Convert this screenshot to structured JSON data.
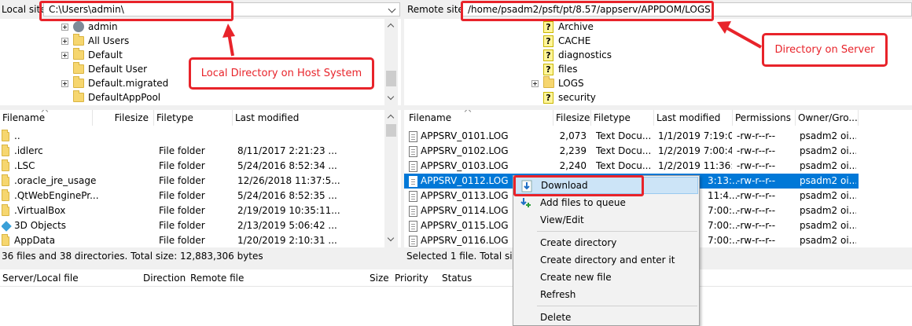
{
  "local": {
    "site_label": "Local site:",
    "path": "C:\\Users\\admin\\",
    "tree": [
      {
        "label": "admin",
        "icon": "user-icon",
        "expander": true
      },
      {
        "label": "All Users",
        "icon": "folder-icon",
        "expander": true
      },
      {
        "label": "Default",
        "icon": "folder-icon",
        "expander": true
      },
      {
        "label": "Default User",
        "icon": "folder-icon",
        "expander": false
      },
      {
        "label": "Default.migrated",
        "icon": "folder-icon",
        "expander": true
      },
      {
        "label": "DefaultAppPool",
        "icon": "folder-icon",
        "expander": false
      }
    ],
    "columns": {
      "filename": "Filename",
      "filesize": "Filesize",
      "filetype": "Filetype",
      "modified": "Last modified"
    },
    "files": [
      {
        "name": "..",
        "type": "",
        "modified": ""
      },
      {
        "name": ".idlerc",
        "type": "File folder",
        "modified": "8/11/2017 2:21:23 ..."
      },
      {
        "name": ".LSC",
        "type": "File folder",
        "modified": "5/24/2016 8:52:34 ..."
      },
      {
        "name": ".oracle_jre_usage",
        "type": "File folder",
        "modified": "12/26/2018 11:37:5..."
      },
      {
        "name": ".QtWebEnginePr...",
        "type": "File folder",
        "modified": "5/24/2016 8:52:35 ..."
      },
      {
        "name": ".VirtualBox",
        "type": "File folder",
        "modified": "2/19/2019 10:35:11..."
      },
      {
        "name": "3D Objects",
        "type": "File folder",
        "modified": "2/13/2019 5:06:42 ..."
      },
      {
        "name": "AppData",
        "type": "File folder",
        "modified": "1/20/2019 2:10:31 ..."
      }
    ],
    "status": "36 files and 38 directories. Total size: 12,883,306 bytes"
  },
  "remote": {
    "site_label": "Remote site:",
    "path": "/home/psadm2/psft/pt/8.57/appserv/APPDOM/LOGS",
    "tree": [
      {
        "label": "Archive",
        "expander": false
      },
      {
        "label": "CACHE",
        "expander": false
      },
      {
        "label": "diagnostics",
        "expander": false
      },
      {
        "label": "files",
        "expander": false
      },
      {
        "label": "LOGS",
        "expander": true,
        "folder": true
      },
      {
        "label": "security",
        "expander": false
      }
    ],
    "columns": {
      "filename": "Filename",
      "filesize": "Filesize",
      "filetype": "Filetype",
      "modified": "Last modified",
      "permissions": "Permissions",
      "owner": "Owner/Gro..."
    },
    "files": [
      {
        "name": "APPSRV_0101.LOG",
        "size": "2,073",
        "type": "Text Docu...",
        "modified": "1/1/2019 7:19:0...",
        "perm": "-rw-r--r--",
        "owner": "psadm2 oi..."
      },
      {
        "name": "APPSRV_0102.LOG",
        "size": "2,239",
        "type": "Text Docu...",
        "modified": "1/2/2019 7:00:4...",
        "perm": "-rw-r--r--",
        "owner": "psadm2 oi..."
      },
      {
        "name": "APPSRV_0103.LOG",
        "size": "2,240",
        "type": "Text Docu...",
        "modified": "1/2/2019 11:36:...",
        "perm": "-rw-r--r--",
        "owner": "psadm2 oi..."
      },
      {
        "name": "APPSRV_0112.LOG",
        "size": "",
        "type": "",
        "modified": "3:13:...",
        "perm": "-rw-r--r--",
        "owner": "psadm2 oi...",
        "selected": true
      },
      {
        "name": "APPSRV_0113.LOG",
        "size": "",
        "type": "",
        "modified": "11:4...",
        "perm": "-rw-r--r--",
        "owner": "psadm2 oi..."
      },
      {
        "name": "APPSRV_0114.LOG",
        "size": "",
        "type": "",
        "modified": "7:00:...",
        "perm": "-rw-r--r--",
        "owner": "psadm2 oi..."
      },
      {
        "name": "APPSRV_0115.LOG",
        "size": "",
        "type": "",
        "modified": "7:00:...",
        "perm": "-rw-r--r--",
        "owner": "psadm2 oi..."
      },
      {
        "name": "APPSRV_0116.LOG",
        "size": "",
        "type": "",
        "modified": "7:00:...",
        "perm": "-rw-r--r--",
        "owner": "psadm2 oi..."
      }
    ],
    "status": "Selected 1 file. Total size: 1"
  },
  "queue": {
    "columns": {
      "server_local": "Server/Local file",
      "direction": "Direction",
      "remote": "Remote file",
      "size": "Size",
      "priority": "Priority",
      "status": "Status"
    }
  },
  "context_menu": {
    "items": {
      "download": "Download",
      "add_queue": "Add files to queue",
      "view_edit": "View/Edit",
      "create_dir": "Create directory",
      "create_dir_enter": "Create directory and enter it",
      "create_file": "Create new file",
      "refresh": "Refresh",
      "delete": "Delete"
    }
  },
  "annotations": {
    "local_dir": "Local Directory on Host System",
    "server_dir": "Directory on Server"
  },
  "colors": {
    "accent_red": "#e8232a",
    "selection_blue": "#0078d7",
    "menu_hover": "#cce4f7"
  }
}
